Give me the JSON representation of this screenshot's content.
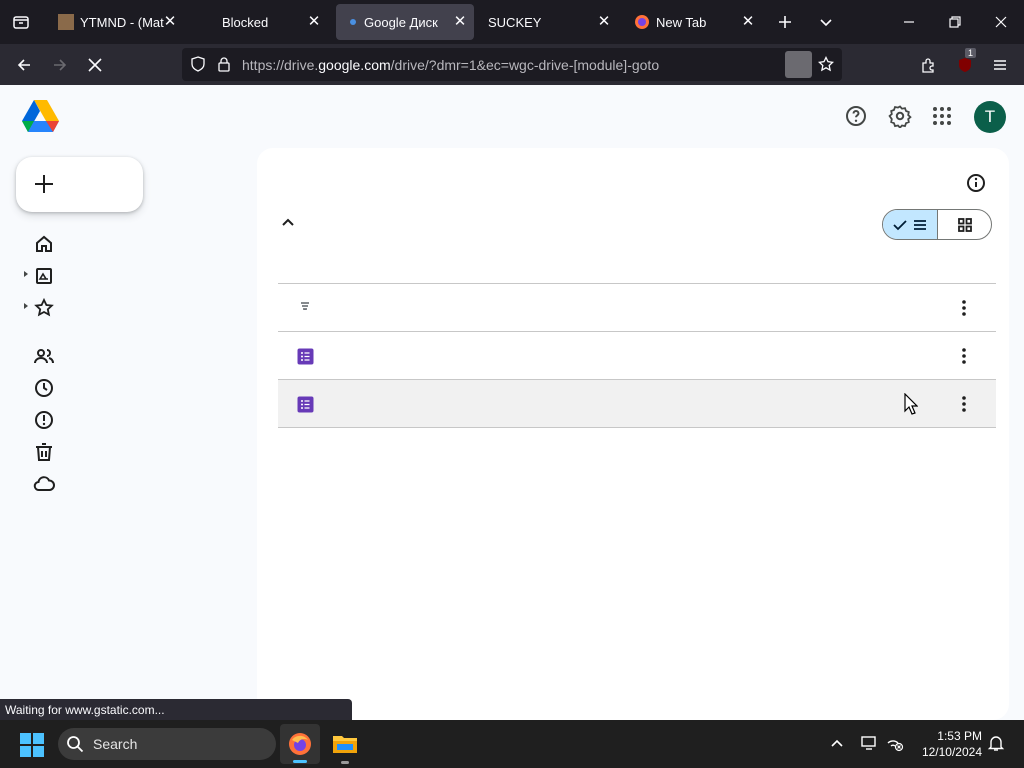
{
  "browser": {
    "tabs": [
      {
        "title": "YTMND - (Matu",
        "active": false
      },
      {
        "title": "Blocked",
        "active": false
      },
      {
        "title": "Google Диск",
        "active": true
      },
      {
        "title": "SUCKEY",
        "active": false
      },
      {
        "title": "New Tab",
        "active": false
      }
    ],
    "url_prefix": "https://drive.",
    "url_domain": "google.com",
    "url_suffix": "/drive/?dmr=1&ec=wgc-drive-[module]-goto",
    "extension_badge": "1",
    "status_text": "Waiting for www.gstatic.com..."
  },
  "drive": {
    "avatar_letter": "T",
    "nav_icons": [
      "home-icon",
      "my-drive-icon",
      "starred-icon",
      "shared-icon",
      "recent-icon",
      "spam-icon",
      "trash-icon",
      "storage-icon"
    ],
    "rows": [
      {
        "icon": "filter-icon"
      },
      {
        "icon": "forms-icon"
      },
      {
        "icon": "forms-icon"
      }
    ],
    "colors": {
      "accent": "#c2e7ff",
      "forms": "#673ab7",
      "avatar": "#0b5f4a"
    }
  },
  "taskbar": {
    "search_label": "Search",
    "time": "1:53 PM",
    "date": "12/10/2024"
  }
}
